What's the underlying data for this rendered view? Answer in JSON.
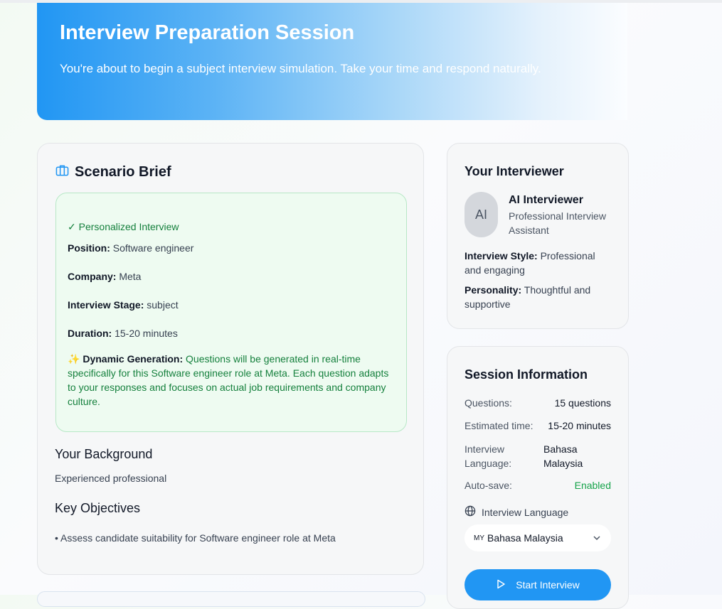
{
  "hero": {
    "title": "Interview Preparation Session",
    "subtitle": "You're about to begin a subject interview simulation. Take your time and respond naturally."
  },
  "brief": {
    "icon": "briefcase-icon",
    "title": "Scenario Brief",
    "personalized": "✓ Personalized Interview",
    "position_label": "Position:",
    "position_value": "Software engineer",
    "company_label": "Company:",
    "company_value": "Meta",
    "stage_label": "Interview Stage:",
    "stage_value": "subject",
    "duration_label": "Duration:",
    "duration_value": "15-20 minutes",
    "dynamic_emoji": "✨",
    "dynamic_label": "Dynamic Generation:",
    "dynamic_text": "Questions will be generated in real-time specifically for this Software engineer role at Meta. Each question adapts to your responses and focuses on actual job requirements and company culture.",
    "background_heading": "Your Background",
    "background_text": "Experienced professional",
    "objectives_heading": "Key Objectives",
    "objective_1": "• Assess candidate suitability for Software engineer role at Meta"
  },
  "interviewer": {
    "heading": "Your Interviewer",
    "avatar_text": "AI",
    "name": "AI Interviewer",
    "role": "Professional Interview Assistant",
    "style_label": "Interview Style:",
    "style_value": "Professional and engaging",
    "personality_label": "Personality:",
    "personality_value": "Thoughtful and supportive"
  },
  "session": {
    "heading": "Session Information",
    "questions_label": "Questions:",
    "questions_value": "15 questions",
    "time_label": "Estimated time:",
    "time_value": "15-20 minutes",
    "language_label": "Interview Language:",
    "language_value": "Bahasa Malaysia",
    "autosave_label": "Auto-save:",
    "autosave_value": "Enabled",
    "lang_select_label": "Interview Language",
    "lang_select_code": "MY",
    "lang_select_value": "Bahasa Malaysia",
    "start_label": "Start Interview"
  },
  "colors": {
    "accent": "#2196f3",
    "green": "#15803d",
    "enabled": "#16a34a"
  }
}
